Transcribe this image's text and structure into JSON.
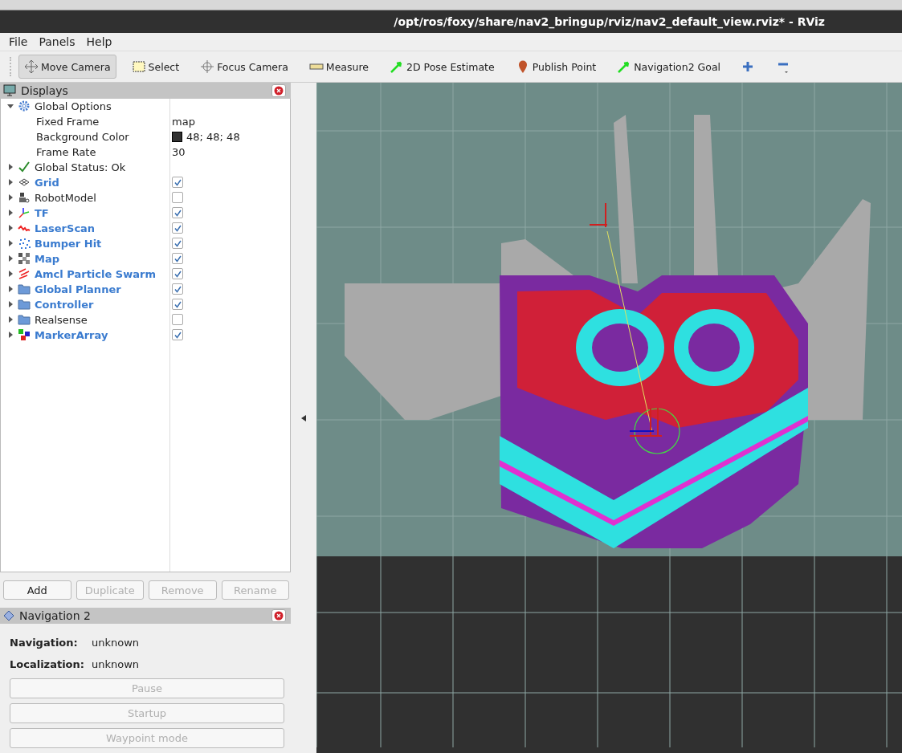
{
  "window": {
    "title": "/opt/ros/foxy/share/nav2_bringup/rviz/nav2_default_view.rviz* - RViz"
  },
  "menu": [
    {
      "label": "File"
    },
    {
      "label": "Panels"
    },
    {
      "label": "Help"
    }
  ],
  "toolbar": [
    {
      "kind": "tool",
      "label": "Move Camera",
      "selected": true
    },
    {
      "kind": "tool",
      "label": "Select",
      "selected": false
    },
    {
      "kind": "tool",
      "label": "Focus Camera",
      "selected": false
    },
    {
      "kind": "tool",
      "label": "Measure",
      "selected": false
    },
    {
      "kind": "tool",
      "label": "2D Pose Estimate",
      "selected": false
    },
    {
      "kind": "tool",
      "label": "Publish Point",
      "selected": false
    },
    {
      "kind": "tool",
      "label": "Navigation2 Goal",
      "selected": false
    },
    {
      "kind": "add"
    },
    {
      "kind": "remove"
    }
  ],
  "displays": {
    "title": "Displays",
    "items": [
      {
        "kind": "options",
        "label": "Global Options",
        "expanded": true,
        "children": [
          {
            "label": "Fixed Frame",
            "value": "map"
          },
          {
            "label": "Background Color",
            "value": "48; 48; 48",
            "color": "#303030"
          },
          {
            "label": "Frame Rate",
            "value": "30"
          }
        ]
      },
      {
        "kind": "status",
        "label": "Global Status: Ok",
        "expanded": false
      },
      {
        "kind": "display",
        "label": "Grid",
        "checked": true,
        "expanded": false
      },
      {
        "kind": "display",
        "label": "RobotModel",
        "checked": false,
        "expanded": false
      },
      {
        "kind": "display",
        "label": "TF",
        "checked": true,
        "expanded": false
      },
      {
        "kind": "display",
        "label": "LaserScan",
        "checked": true,
        "expanded": false
      },
      {
        "kind": "display",
        "label": "Bumper Hit",
        "checked": true,
        "expanded": false
      },
      {
        "kind": "display",
        "label": "Map",
        "checked": true,
        "expanded": false
      },
      {
        "kind": "display",
        "label": "Amcl Particle Swarm",
        "checked": true,
        "expanded": false
      },
      {
        "kind": "display",
        "label": "Global Planner",
        "checked": true,
        "expanded": false
      },
      {
        "kind": "display",
        "label": "Controller",
        "checked": true,
        "expanded": false
      },
      {
        "kind": "display",
        "label": "Realsense",
        "checked": false,
        "expanded": false
      },
      {
        "kind": "display",
        "label": "MarkerArray",
        "checked": true,
        "expanded": false
      }
    ],
    "buttons": [
      {
        "label": "Add",
        "disabled": false
      },
      {
        "label": "Duplicate",
        "disabled": true
      },
      {
        "label": "Remove",
        "disabled": true
      },
      {
        "label": "Rename",
        "disabled": true
      }
    ]
  },
  "navigation": {
    "title": "Navigation 2",
    "fields": [
      {
        "label": "Navigation:",
        "value": "unknown"
      },
      {
        "label": "Localization:",
        "value": "unknown"
      }
    ],
    "buttons": [
      {
        "label": "Pause",
        "disabled": true
      },
      {
        "label": "Startup",
        "disabled": true
      },
      {
        "label": "Waypoint mode",
        "disabled": true
      }
    ]
  }
}
